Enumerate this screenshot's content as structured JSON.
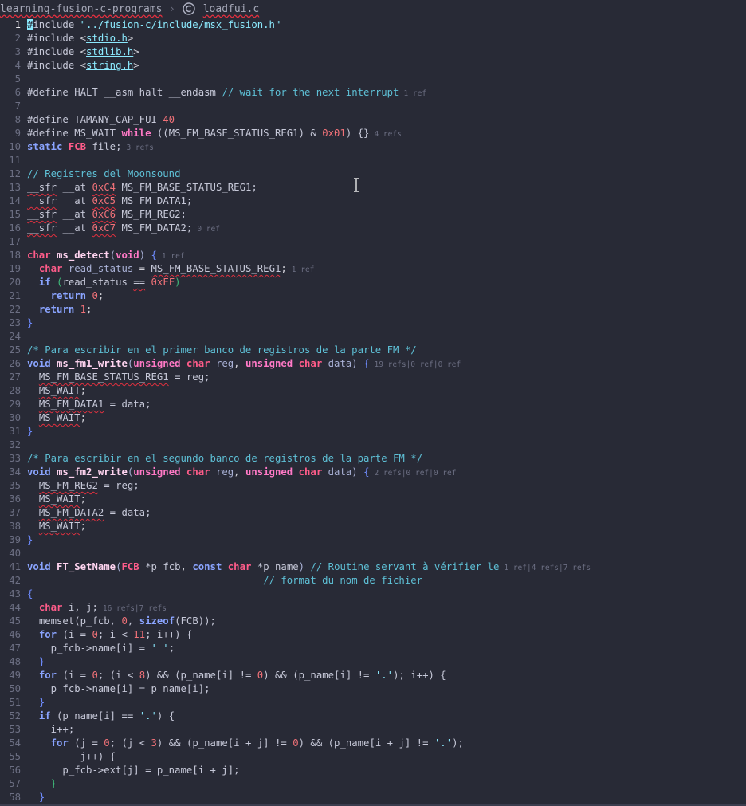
{
  "breadcrumb": {
    "folder": "learning-fusion-c-programs",
    "separator": "›",
    "file": "loadfui.c",
    "file_icon": "c-language-icon"
  },
  "editor": {
    "active_line": 1,
    "lines": [
      {
        "n": "1"
      },
      {
        "n": "2"
      },
      {
        "n": "3"
      },
      {
        "n": "4"
      },
      {
        "n": "5"
      },
      {
        "n": "6"
      },
      {
        "n": "7"
      },
      {
        "n": "8"
      },
      {
        "n": "9"
      },
      {
        "n": "10"
      },
      {
        "n": "11"
      },
      {
        "n": "12"
      },
      {
        "n": "13"
      },
      {
        "n": "14"
      },
      {
        "n": "15"
      },
      {
        "n": "16"
      },
      {
        "n": "17"
      },
      {
        "n": "18"
      },
      {
        "n": "19"
      },
      {
        "n": "20"
      },
      {
        "n": "21"
      },
      {
        "n": "22"
      },
      {
        "n": "23"
      },
      {
        "n": "24"
      },
      {
        "n": "25"
      },
      {
        "n": "26"
      },
      {
        "n": "27"
      },
      {
        "n": "28"
      },
      {
        "n": "29"
      },
      {
        "n": "30"
      },
      {
        "n": "31"
      },
      {
        "n": "32"
      },
      {
        "n": "33"
      },
      {
        "n": "34"
      },
      {
        "n": "35"
      },
      {
        "n": "36"
      },
      {
        "n": "37"
      },
      {
        "n": "38"
      },
      {
        "n": "39"
      },
      {
        "n": "40"
      },
      {
        "n": "41"
      },
      {
        "n": "42"
      },
      {
        "n": "43"
      },
      {
        "n": "44"
      },
      {
        "n": "45"
      },
      {
        "n": "46"
      },
      {
        "n": "47"
      },
      {
        "n": "48"
      },
      {
        "n": "49"
      },
      {
        "n": "50"
      },
      {
        "n": "51"
      },
      {
        "n": "52"
      },
      {
        "n": "53"
      },
      {
        "n": "54"
      },
      {
        "n": "55"
      },
      {
        "n": "56"
      },
      {
        "n": "57"
      },
      {
        "n": "58"
      }
    ]
  },
  "code": {
    "l1_pp": "#include",
    "l1_str": "\"../fusion-c/include/msx_fusion.h\"",
    "l2_pp": "#include",
    "l2_inc": "stdio.h",
    "l3_pp": "#include",
    "l3_inc": "stdlib.h",
    "l4_pp": "#include",
    "l4_inc": "string.h",
    "l6_a": "#define HALT __asm halt __endasm",
    "l6_cm": "// wait for the next interrupt",
    "l6_ref": "1 ref",
    "l8_a": "#define TAMANY_CAP_FUI",
    "l8_num": "40",
    "l9_a": "#define MS_WAIT",
    "l9_kw": "while",
    "l9_b": "((MS_FM_BASE_STATUS_REG1) &",
    "l9_num": "0x01",
    "l9_c": ") {}",
    "l9_ref": "4 refs",
    "l10_kw": "static",
    "l10_ty": "FCB",
    "l10_b": "file;",
    "l10_ref": "3 refs",
    "l12_cm": "// Registres del Moonsound",
    "l13_sfr": "__sfr",
    "l13_at": "__at",
    "l13_num": "0xC4",
    "l13_b": "MS_FM_BASE_STATUS_REG1;",
    "l14_sfr": "__sfr",
    "l14_at": "__at",
    "l14_num": "0xC5",
    "l14_b": "MS_FM_DATA1;",
    "l15_sfr": "__sfr",
    "l15_at": "__at",
    "l15_num": "0xC6",
    "l15_b": "MS_FM_REG2;",
    "l16_sfr": "__sfr",
    "l16_at": "__at",
    "l16_num": "0xC7",
    "l16_b": "MS_FM_DATA2;",
    "l16_ref": "0 ref",
    "l18_ty": "char",
    "l18_fn": "ms_detect",
    "l18_kw": "void",
    "l18_ref": "1 ref",
    "l19_ty": "char",
    "l19_v": "read_status",
    "l19_b": "MS_FM_BASE_STATUS_REG1",
    "l19_ref": "1 ref",
    "l20_kw": "if",
    "l20_v": "read_status",
    "l20_op": "==",
    "l20_num": "0xFF",
    "l21_kw": "return",
    "l21_num": "0",
    "l22_kw": "return",
    "l22_num": "1",
    "l25_cm": "/* Para escribir en el primer banco de registros de la parte FM */",
    "l26_kw": "void",
    "l26_fn": "ms_fm1_write",
    "l26_kw2": "unsigned",
    "l26_ty": "char",
    "l26_p1": "reg",
    "l26_p2": "data",
    "l26_ref": "19 refs|0 ref|0 ref",
    "l27_a": "MS_FM_BASE_STATUS_REG1",
    "l27_b": " = reg;",
    "l28_a": "MS_WAIT",
    "l29_a": "MS_FM_DATA1",
    "l29_b": " = data;",
    "l30_a": "MS_WAIT",
    "l33_cm": "/* Para escribir en el segundo banco de registros de la parte FM */",
    "l34_kw": "void",
    "l34_fn": "ms_fm2_write",
    "l34_ref": "2 refs|0 ref|0 ref",
    "l35_a": "MS_FM_REG2",
    "l35_b": " = reg;",
    "l36_a": "MS_WAIT",
    "l37_a": "MS_FM_DATA2",
    "l37_b": " = data;",
    "l38_a": "MS_WAIT",
    "l41_kw": "void",
    "l41_fn": "FT_SetName",
    "l41_ty1": "FCB",
    "l41_p1": "*p_fcb",
    "l41_const": "const",
    "l41_ty2": "char",
    "l41_p2": "*p_name",
    "l41_cm": "// Routine servant à vérifier le",
    "l41_ref": "1 ref|4 refs|7 refs",
    "l42_cm": "// format du nom de fichier",
    "l44_ty": "char",
    "l44_b": "i, j;",
    "l44_ref": "16 refs|7 refs",
    "l45_a": "memset(p_fcb, ",
    "l45_num": "0",
    "l45_b": ", ",
    "l45_kw": "sizeof",
    "l45_c": "(FCB));",
    "l46_kw": "for",
    "l46_a": "(i = ",
    "l46_num": "0",
    "l46_b": "; i < ",
    "l46_num2": "11",
    "l46_c": "; i++) {",
    "l47_a": "p_fcb->name[i] = ",
    "l47_str": "' '",
    "l47_b": ";",
    "l49_kw": "for",
    "l49_a": "(i = ",
    "l49_num": "0",
    "l49_b": "; (i < ",
    "l49_num2": "8",
    "l49_c": ") && (p_name[i] != ",
    "l49_num3": "0",
    "l49_d": ") && (p_name[i] != ",
    "l49_str": "'.'",
    "l49_e": "); i++) {",
    "l50_a": "p_fcb->name[i] = p_name[i];",
    "l52_kw": "if",
    "l52_a": "(p_name[i] == ",
    "l52_str": "'.'",
    "l52_b": ") {",
    "l53_a": "i++;",
    "l54_kw": "for",
    "l54_a": "(j = ",
    "l54_num": "0",
    "l54_b": "; (j < ",
    "l54_num2": "3",
    "l54_c": ") && (p_name[i + j] != ",
    "l54_num3": "0",
    "l54_d": ") && (p_name[i + j] != ",
    "l54_str": "'.'",
    "l54_e": ");",
    "l55_a": "j++) {",
    "l56_a": "p_fcb->ext[j] = p_name[i + j];"
  },
  "colors": {
    "background": "#282a36",
    "keyword": "#ff79c6",
    "string": "#8be9fd",
    "number": "#f07178",
    "comment": "#5ec0d6",
    "error_squiggle": "#e0303f"
  }
}
